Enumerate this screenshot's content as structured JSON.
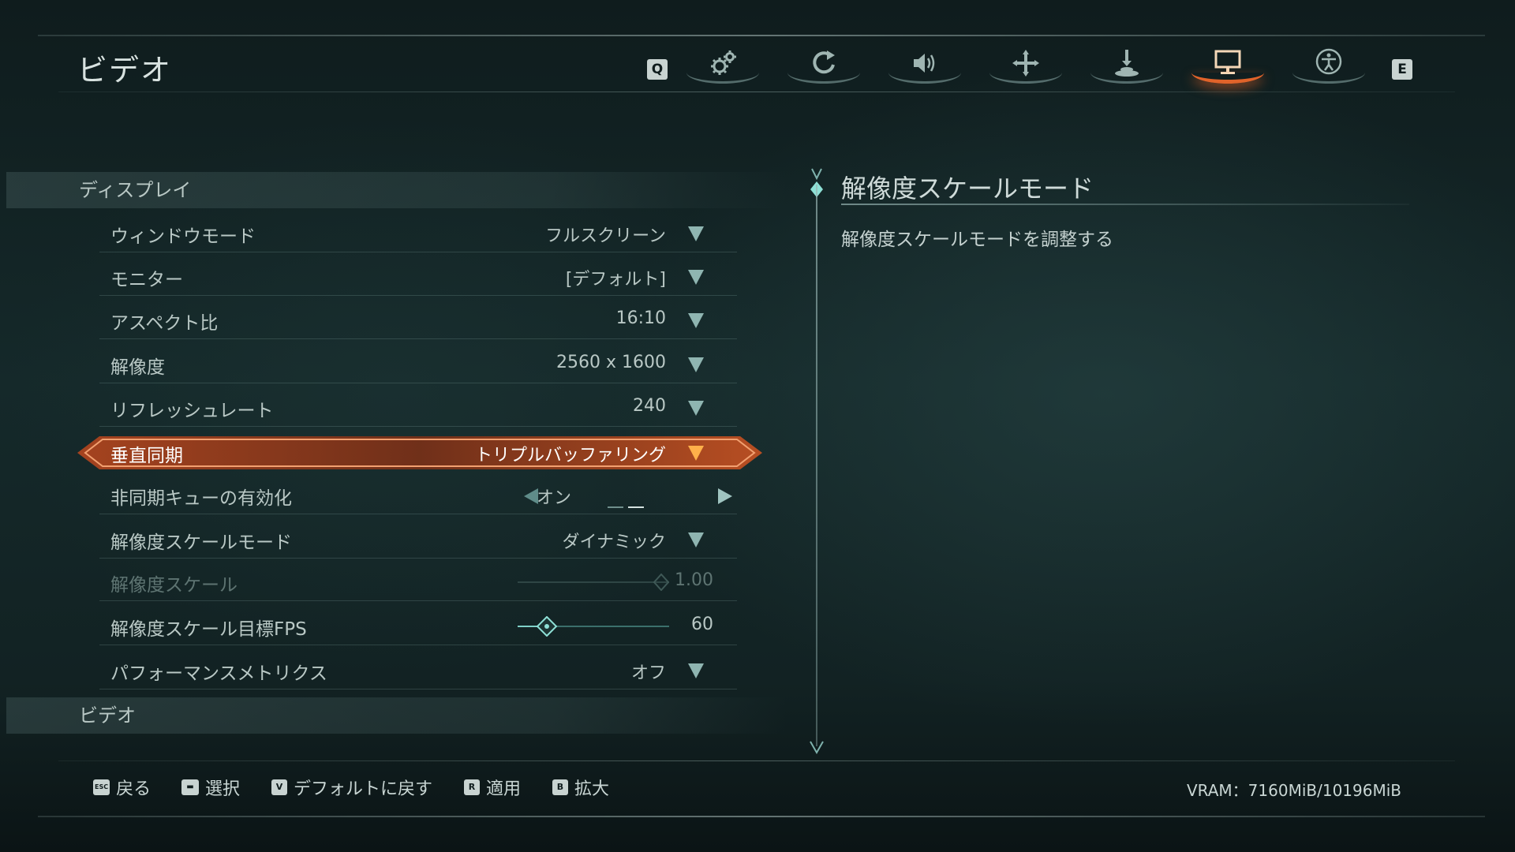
{
  "page": {
    "title": "ビデオ"
  },
  "tabs": {
    "prev_key": "Q",
    "next_key": "E",
    "items": [
      {
        "icon": "gear-icon",
        "active": false
      },
      {
        "icon": "refresh-icon",
        "active": false
      },
      {
        "icon": "speaker-icon",
        "active": false
      },
      {
        "icon": "dpad-cross-icon",
        "active": false
      },
      {
        "icon": "joystick-icon",
        "active": false
      },
      {
        "icon": "monitor-icon",
        "active": true
      },
      {
        "icon": "accessibility-icon",
        "active": false
      }
    ]
  },
  "sections": {
    "display": "ディスプレイ",
    "video": "ビデオ"
  },
  "settings": [
    {
      "label": "ウィンドウモード",
      "value": "フルスクリーン",
      "control": "dropdown"
    },
    {
      "label": "モニター",
      "value": "[デフォルト]",
      "control": "dropdown"
    },
    {
      "label": "アスペクト比",
      "value": "16:10",
      "control": "dropdown"
    },
    {
      "label": "解像度",
      "value": "2560 x 1600",
      "control": "dropdown"
    },
    {
      "label": "リフレッシュレート",
      "value": "240",
      "control": "dropdown"
    },
    {
      "label": "垂直同期",
      "value": "トリプルバッファリング",
      "control": "dropdown",
      "selected": true
    },
    {
      "label": "非同期キューの有効化",
      "value": "オン",
      "control": "toggle"
    },
    {
      "label": "解像度スケールモード",
      "value": "ダイナミック",
      "control": "dropdown"
    },
    {
      "label": "解像度スケール",
      "value": "1.00",
      "control": "slider",
      "disabled": true,
      "level": 1.0
    },
    {
      "label": "解像度スケール目標FPS",
      "value": "60",
      "control": "slider",
      "level": 0.2
    },
    {
      "label": "パフォーマンスメトリクス",
      "value": "オフ",
      "control": "dropdown"
    }
  ],
  "detail": {
    "title": "解像度スケールモード",
    "description": "解像度スケールモードを調整する"
  },
  "footer": {
    "back": {
      "key": "ESC",
      "label": "戻る"
    },
    "select": {
      "key": "▬",
      "label": "選択"
    },
    "reset": {
      "key": "V",
      "label": "デフォルトに戻す"
    },
    "apply": {
      "key": "R",
      "label": "適用"
    },
    "zoom": {
      "key": "B",
      "label": "拡大"
    },
    "vram": "VRAM：7160MiB/10196MiB"
  },
  "colors": {
    "accent": "#e0632a",
    "teal": "#6fa8a4"
  }
}
